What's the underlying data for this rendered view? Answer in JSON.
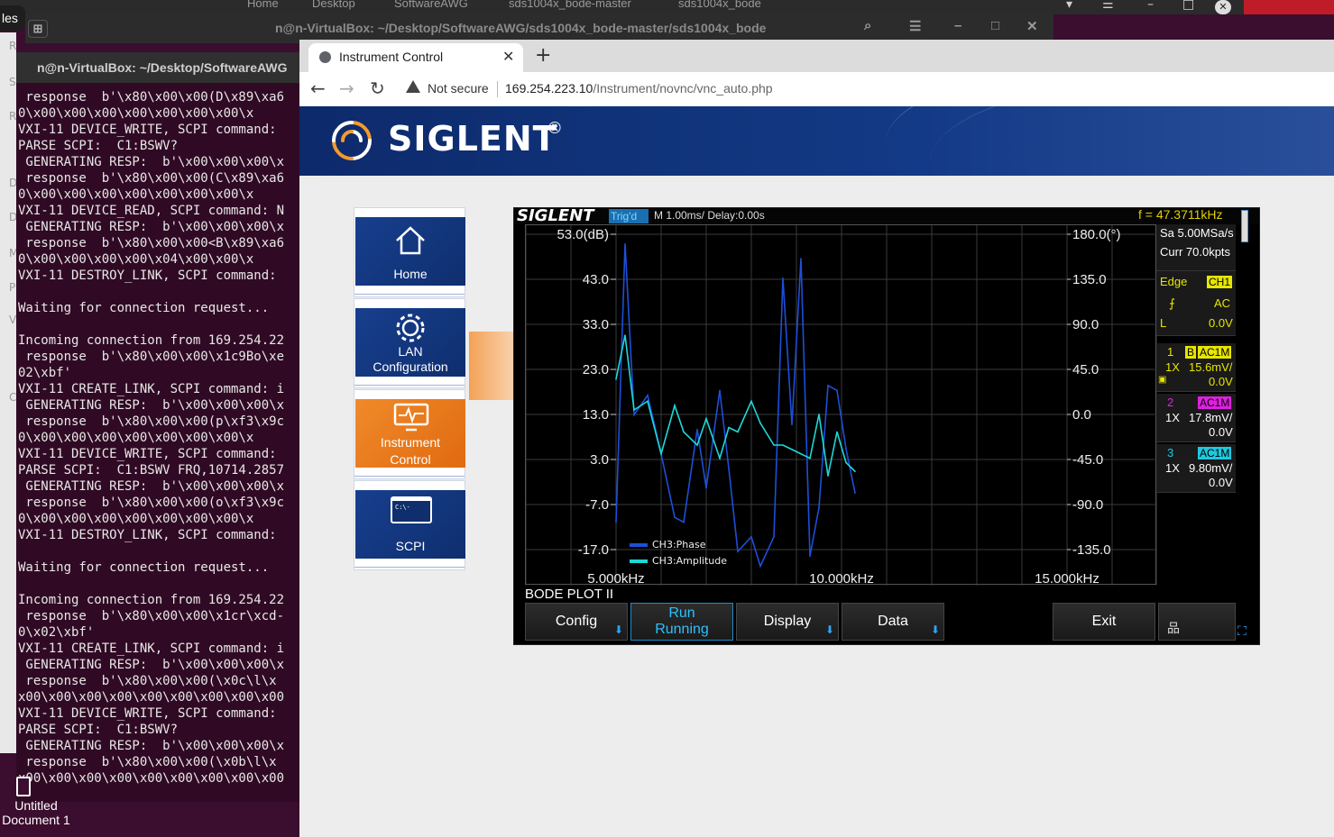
{
  "back_topbar": {
    "tabs": [
      "Home",
      "Desktop",
      "SoftwareAWG",
      "sds1004x_bode-master",
      "sds1004x_bode"
    ]
  },
  "files_label": "les",
  "left_strip_letters": [
    "R",
    "S",
    "R",
    "D",
    "D",
    "M",
    "P",
    "V",
    "C"
  ],
  "term1": {
    "title": "n@n-VirtualBox: ~/Desktop/SoftwareAWG/sds1004x_bode-master/sds1004x_bode"
  },
  "term2": {
    "title": "n@n-VirtualBox: ~/Desktop/SoftwareAWG",
    "lines": [
      " response  b'\\x80\\x00\\x00(D\\x89\\xa6",
      "0\\x00\\x00\\x00\\x00\\x00\\x00\\x00\\x",
      "VXI-11 DEVICE_WRITE, SCPI command: ",
      "PARSE SCPI:  C1:BSWV?",
      " GENERATING RESP:  b'\\x00\\x00\\x00\\x",
      " response  b'\\x80\\x00\\x00(C\\x89\\xa6",
      "0\\x00\\x00\\x00\\x00\\x00\\x00\\x00\\x",
      "VXI-11 DEVICE_READ, SCPI command: N",
      " GENERATING RESP:  b'\\x00\\x00\\x00\\x",
      " response  b'\\x80\\x00\\x00<B\\x89\\xa6",
      "0\\x00\\x00\\x00\\x00\\x04\\x00\\x00\\x",
      "VXI-11 DESTROY_LINK, SCPI command: ",
      "",
      "Waiting for connection request...",
      "",
      "Incoming connection from 169.254.22",
      " response  b'\\x80\\x00\\x00\\x1c9Bo\\xe",
      "02\\xbf'",
      "VXI-11 CREATE_LINK, SCPI command: i",
      " GENERATING RESP:  b'\\x00\\x00\\x00\\x",
      " response  b'\\x80\\x00\\x00(p\\xf3\\x9c",
      "0\\x00\\x00\\x00\\x00\\x00\\x00\\x00\\x",
      "VXI-11 DEVICE_WRITE, SCPI command: ",
      "PARSE SCPI:  C1:BSWV FRQ,10714.2857",
      " GENERATING RESP:  b'\\x00\\x00\\x00\\x",
      " response  b'\\x80\\x00\\x00(o\\xf3\\x9c",
      "0\\x00\\x00\\x00\\x00\\x00\\x00\\x00\\x",
      "VXI-11 DESTROY_LINK, SCPI command: ",
      "",
      "Waiting for connection request...",
      "",
      "Incoming connection from 169.254.22",
      " response  b'\\x80\\x00\\x00\\x1cr\\xcd-",
      "0\\x02\\xbf'",
      "VXI-11 CREATE_LINK, SCPI command: i",
      " GENERATING RESP:  b'\\x00\\x00\\x00\\x",
      " response  b'\\x80\\x00\\x00(\\x0c\\l\\x",
      "x00\\x00\\x00\\x00\\x00\\x00\\x00\\x00\\x00",
      "VXI-11 DEVICE_WRITE, SCPI command: ",
      "PARSE SCPI:  C1:BSWV?",
      " GENERATING RESP:  b'\\x00\\x00\\x00\\x",
      " response  b'\\x80\\x00\\x00(\\x0b\\l\\x",
      "x00\\x00\\x00\\x00\\x00\\x00\\x00\\x00\\x00"
    ]
  },
  "desktop_icon": {
    "line1": "Untitled",
    "line2": "Document 1"
  },
  "browser": {
    "tab_title": "Instrument Control",
    "security": "Not secure",
    "url_host": "169.254.223.10",
    "url_path": "/Instrument/novnc/vnc_auto.php"
  },
  "siglent": {
    "logo": "SIGLENT",
    "reg": "®"
  },
  "menu": [
    {
      "label1": "Home",
      "label2": "",
      "icon": "home-icon"
    },
    {
      "label1": "LAN",
      "label2": "Configuration",
      "icon": "gear-icon"
    },
    {
      "label1": "Instrument",
      "label2": "Control",
      "icon": "monitor-pulse-icon",
      "active": true
    },
    {
      "label1": "SCPI",
      "label2": "",
      "icon": "terminal-icon"
    }
  ],
  "scope": {
    "brand": "SIGLENT",
    "trig": "Trig'd",
    "timebase": "M 1.00ms/ Delay:0.00s",
    "freq": "f = 47.3711kHz",
    "panel": {
      "sa": "Sa 5.00MSa/s",
      "curr": "Curr 70.0kpts",
      "trig_type": "Edge",
      "trig_src": "CH1",
      "slope_coupling": "AC",
      "level_label": "L",
      "level": "0.0V",
      "channels": [
        {
          "num": "1",
          "flag": "B",
          "coupling": "AC1M",
          "probe": "1X",
          "scale": "15.6mV/",
          "offset": "0.0V",
          "color": "#e6e600"
        },
        {
          "num": "2",
          "flag": "",
          "coupling": "AC1M",
          "probe": "1X",
          "scale": "17.8mV/",
          "offset": "0.0V",
          "color": "#e020e0"
        },
        {
          "num": "3",
          "flag": "",
          "coupling": "AC1M",
          "probe": "1X",
          "scale": "9.80mV/",
          "offset": "0.0V",
          "color": "#1ec8e0"
        }
      ]
    },
    "mode_label": "BODE PLOT II",
    "buttons": {
      "config": "Config",
      "run1": "Run",
      "run2": "Running",
      "display": "Display",
      "data": "Data",
      "exit": "Exit"
    }
  },
  "chart_data": {
    "type": "line",
    "x_ticks": [
      "5.000kHz",
      "10.000kHz",
      "15.000kHz"
    ],
    "xlim": [
      5000,
      15000
    ],
    "y_left_ticks": [
      "53.0(dB)",
      "43.0",
      "33.0",
      "23.0",
      "13.0",
      "3.0",
      "-7.0",
      "-17.0"
    ],
    "y_left_lim": [
      -27,
      53
    ],
    "y_right_ticks": [
      "180.0(°)",
      "135.0",
      "90.0",
      "45.0",
      "0.0",
      "-45.0",
      "-90.0",
      "-135.0"
    ],
    "y_right_lim": [
      -180,
      180
    ],
    "series": [
      {
        "name": "CH3:Phase",
        "color": "#1d4fd8",
        "axis": "right",
        "x": [
          5000,
          5200,
          5400,
          5700,
          6000,
          6300,
          6500,
          6800,
          7000,
          7300,
          7500,
          7700,
          8000,
          8200,
          8500,
          8700,
          8900,
          9100,
          9300,
          9500,
          9700,
          9900,
          10100,
          10300
        ],
        "y": [
          -115,
          170,
          -5,
          15,
          -45,
          -110,
          -115,
          -20,
          -80,
          20,
          -60,
          -145,
          -130,
          -160,
          -130,
          135,
          -15,
          155,
          -150,
          -100,
          25,
          20,
          -40,
          -85
        ]
      },
      {
        "name": "CH3:Amplitude",
        "color": "#1ed8d8",
        "axis": "left",
        "x": [
          5000,
          5200,
          5400,
          5700,
          6000,
          6300,
          6500,
          6800,
          7000,
          7300,
          7500,
          7700,
          8000,
          8200,
          8500,
          8700,
          8900,
          9100,
          9300,
          9500,
          9700,
          9900,
          10100,
          10300
        ],
        "y": [
          20,
          30,
          13,
          15,
          3,
          14,
          8,
          5,
          11,
          2,
          9,
          8,
          15,
          10,
          5,
          5,
          4,
          3,
          2,
          12,
          -2,
          8,
          1,
          -1
        ]
      }
    ],
    "legend": "bottom-left",
    "grid": true
  }
}
